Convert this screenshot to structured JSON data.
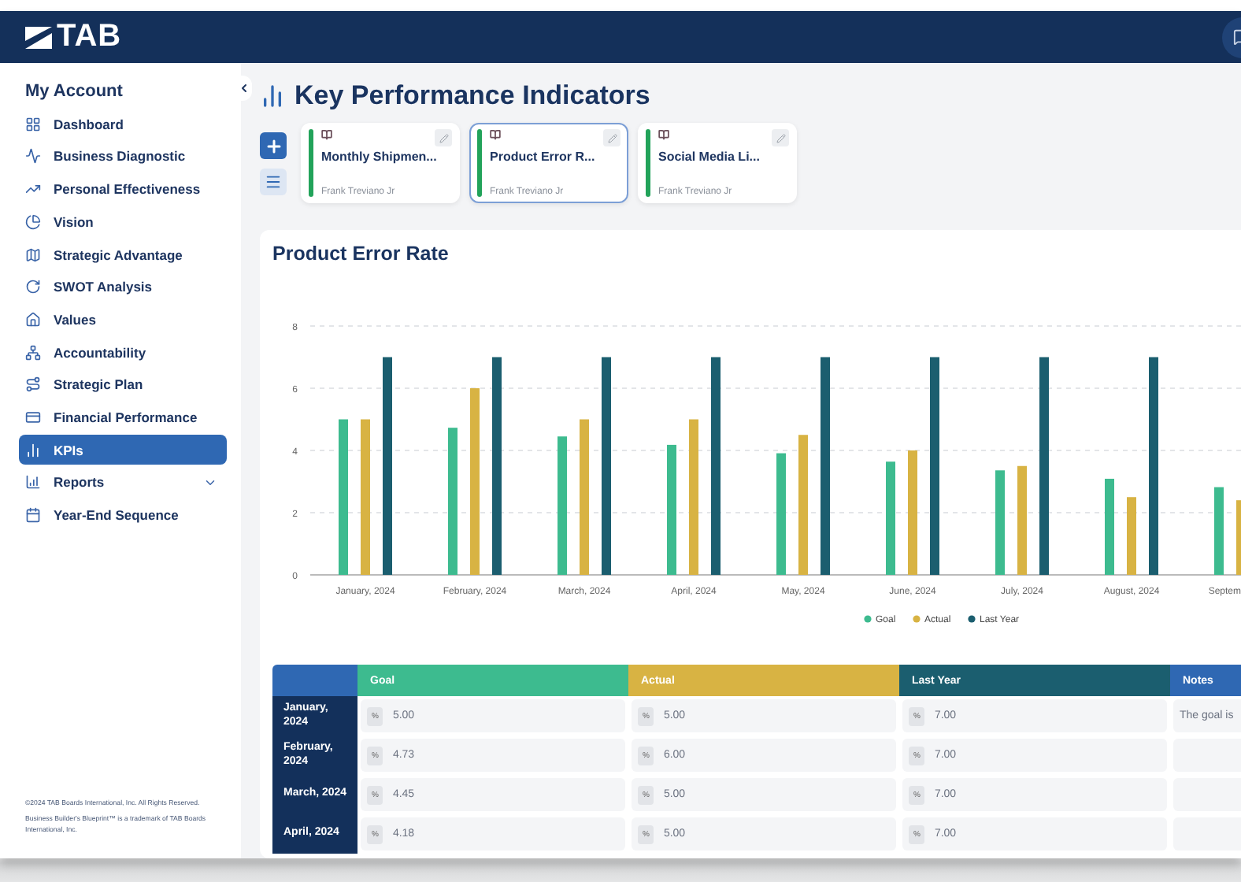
{
  "header": {
    "logo": "TAB"
  },
  "sidebar": {
    "title": "My Account",
    "items": [
      {
        "label": "Dashboard",
        "kind": "link",
        "selected": false
      },
      {
        "label": "Business Diagnostic",
        "kind": "link",
        "selected": false
      },
      {
        "label": "Personal Effectiveness",
        "kind": "link",
        "selected": false
      },
      {
        "label": "Vision",
        "kind": "link",
        "selected": false
      },
      {
        "label": "Strategic Advantage",
        "kind": "link",
        "selected": false
      },
      {
        "label": "SWOT Analysis",
        "kind": "link",
        "selected": false
      },
      {
        "label": "Values",
        "kind": "link",
        "selected": false
      },
      {
        "label": "Accountability",
        "kind": "link",
        "selected": false
      },
      {
        "label": "Strategic Plan",
        "kind": "link",
        "selected": false
      },
      {
        "label": "Financial Performance",
        "kind": "link",
        "selected": false
      },
      {
        "label": "KPIs",
        "kind": "link",
        "selected": true
      },
      {
        "label": "Reports",
        "kind": "group",
        "selected": false
      },
      {
        "label": "Year-End Sequence",
        "kind": "link",
        "selected": false
      }
    ],
    "footer": [
      "©2024 TAB Boards International, Inc. All Rights Reserved.",
      "Business Builder's Blueprint™ is a trademark of TAB Boards International, Inc."
    ]
  },
  "page": {
    "title": "Key Performance Indicators"
  },
  "kpi_cards": [
    {
      "title": "Monthly Shipmen...",
      "owner": "Frank Treviano Jr",
      "selected": false
    },
    {
      "title": "Product Error R...",
      "owner": "Frank Treviano Jr",
      "selected": true
    },
    {
      "title": "Social Media Li...",
      "owner": "Frank Treviano Jr",
      "selected": false
    }
  ],
  "chart_panel": {
    "title": "Product Error Rate",
    "chart_data": {
      "type": "bar",
      "categories": [
        "January, 2024",
        "February, 2024",
        "March, 2024",
        "April, 2024",
        "May, 2024",
        "June, 2024",
        "July, 2024",
        "August, 2024",
        "Septem"
      ],
      "ylim": [
        0,
        8
      ],
      "grid": true,
      "legend": true,
      "yticks": [
        0,
        2,
        4,
        6,
        8
      ],
      "series": [
        {
          "name": "Goal",
          "color": "#3dbb8f",
          "values": [
            5,
            4.73,
            4.45,
            4.18,
            3.91,
            3.64,
            3.36,
            3.09,
            2.82
          ]
        },
        {
          "name": "Actual",
          "color": "#d8b343",
          "values": [
            5,
            6,
            5,
            5,
            4.5,
            4,
            3.5,
            2.5,
            2.4
          ]
        },
        {
          "name": "Last Year",
          "color": "#1b5e6f",
          "values": [
            7,
            7,
            7,
            7,
            7,
            7,
            7,
            7,
            null
          ]
        }
      ]
    }
  },
  "table": {
    "columns": [
      {
        "label": "Goal",
        "color": "#3dbb8f"
      },
      {
        "label": "Actual",
        "color": "#d8b343"
      },
      {
        "label": "Last Year",
        "color": "#1b5e6f"
      },
      {
        "label": "Notes",
        "color": "#2f68b3"
      }
    ],
    "rows": [
      {
        "label": "January, 2024",
        "cells": [
          {
            "unit": "%",
            "value": "5.00"
          },
          {
            "unit": "%",
            "value": "5.00"
          },
          {
            "unit": "%",
            "value": "7.00"
          },
          {
            "value": "The goal is"
          }
        ]
      },
      {
        "label": "February, 2024",
        "cells": [
          {
            "unit": "%",
            "value": "4.73"
          },
          {
            "unit": "%",
            "value": "6.00"
          },
          {
            "unit": "%",
            "value": "7.00"
          },
          {}
        ]
      },
      {
        "label": "March, 2024",
        "cells": [
          {
            "unit": "%",
            "value": "4.45"
          },
          {
            "unit": "%",
            "value": "5.00"
          },
          {
            "unit": "%",
            "value": "7.00"
          },
          {}
        ]
      },
      {
        "label": "April, 2024",
        "cells": [
          {
            "unit": "%",
            "value": "4.18"
          },
          {
            "unit": "%",
            "value": "5.00"
          },
          {
            "unit": "%",
            "value": "7.00"
          },
          {}
        ]
      }
    ]
  }
}
